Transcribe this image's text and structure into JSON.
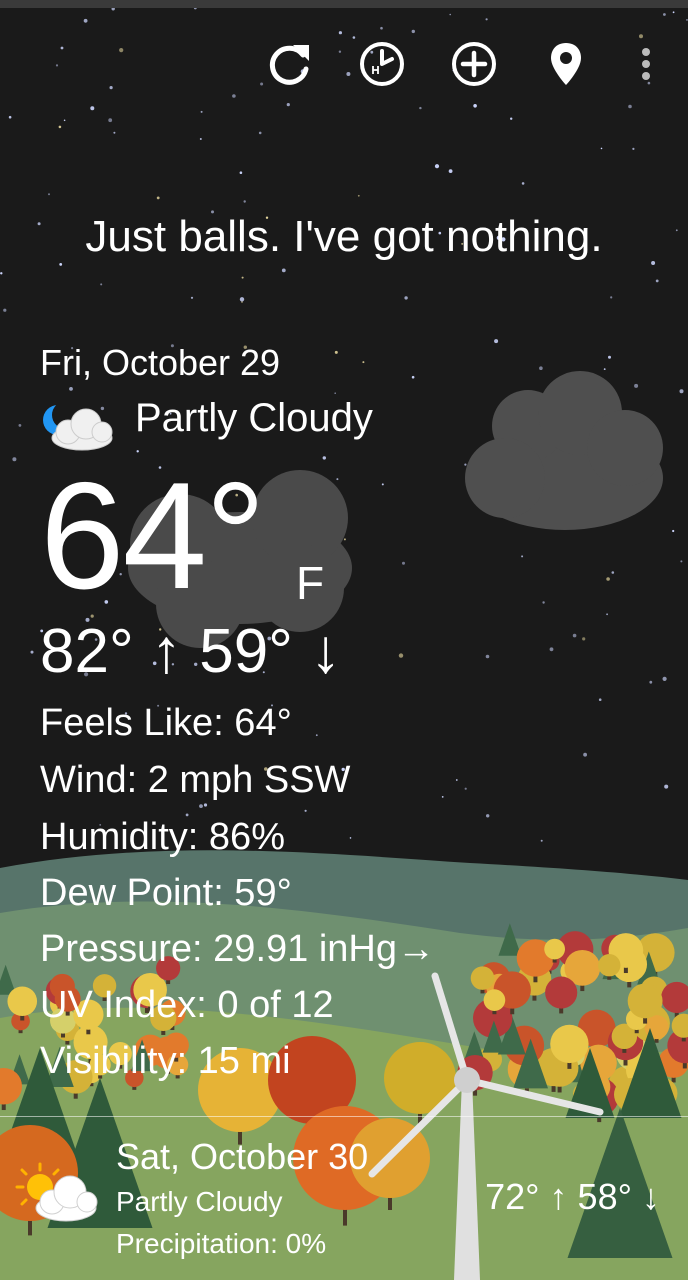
{
  "toolbar": {
    "refresh_icon": "refresh-icon",
    "history_icon": "clock-history-icon",
    "add_icon": "add-circle-icon",
    "location_icon": "location-pin-icon",
    "menu_icon": "more-vert-icon"
  },
  "joke": "Just balls. I've got nothing.",
  "current": {
    "date": "Fri, October 29",
    "condition": "Partly Cloudy",
    "condition_icon": "partly-cloudy-night-icon",
    "temperature": "64°",
    "unit": "F",
    "hi_lo": "82° ↑ 59° ↓",
    "details": [
      "Feels Like:  64°",
      "Wind:  2 mph SSW",
      "Humidity:  86%",
      "Dew Point:  59°",
      "Pressure:  29.91 inHg→",
      "UV Index:  0 of 12",
      "Visibility:  15 mi"
    ]
  },
  "forecast": {
    "date": "Sat, October 30",
    "condition": "Partly Cloudy",
    "precipitation": "Precipitation:  0%",
    "hi_lo": "72° ↑  58° ↓",
    "condition_icon": "partly-sunny-icon"
  },
  "colors": {
    "sky": "#1a1a1a",
    "hills": "#7c9c68",
    "cloud": "#555555"
  }
}
